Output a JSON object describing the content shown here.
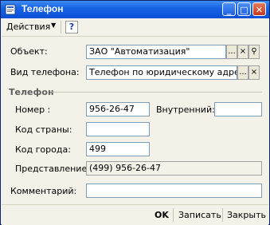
{
  "window": {
    "title": "Телефон",
    "icon": "phone-form-icon"
  },
  "toolbar": {
    "actions_label": "Действия",
    "help_label": "?"
  },
  "form": {
    "object": {
      "label": "Объект:",
      "value": "ЗАО \"Автоматизация\""
    },
    "phone_type": {
      "label": "Вид телефона:",
      "value": "Телефон по юридическому адресу орг"
    },
    "group_title": "Телефон",
    "number": {
      "label": "Номер :",
      "value": "956-26-47"
    },
    "internal": {
      "label": "Внутренний:",
      "value": ""
    },
    "country_code": {
      "label": "Код страны:",
      "value": ""
    },
    "city_code": {
      "label": "Код города:",
      "value": "499"
    },
    "representation": {
      "label": "Представление:",
      "value": "(499) 956-26-47"
    },
    "comment": {
      "label": "Комментарий:",
      "value": ""
    }
  },
  "field_buttons": {
    "select": "...",
    "clear": "×",
    "open": "⚲"
  },
  "footer": {
    "ok": "OK",
    "save": "Записать",
    "close": "Закрыть"
  },
  "colors": {
    "titlebar": "#0b4fd6",
    "window_bg": "#f3f1e8"
  }
}
